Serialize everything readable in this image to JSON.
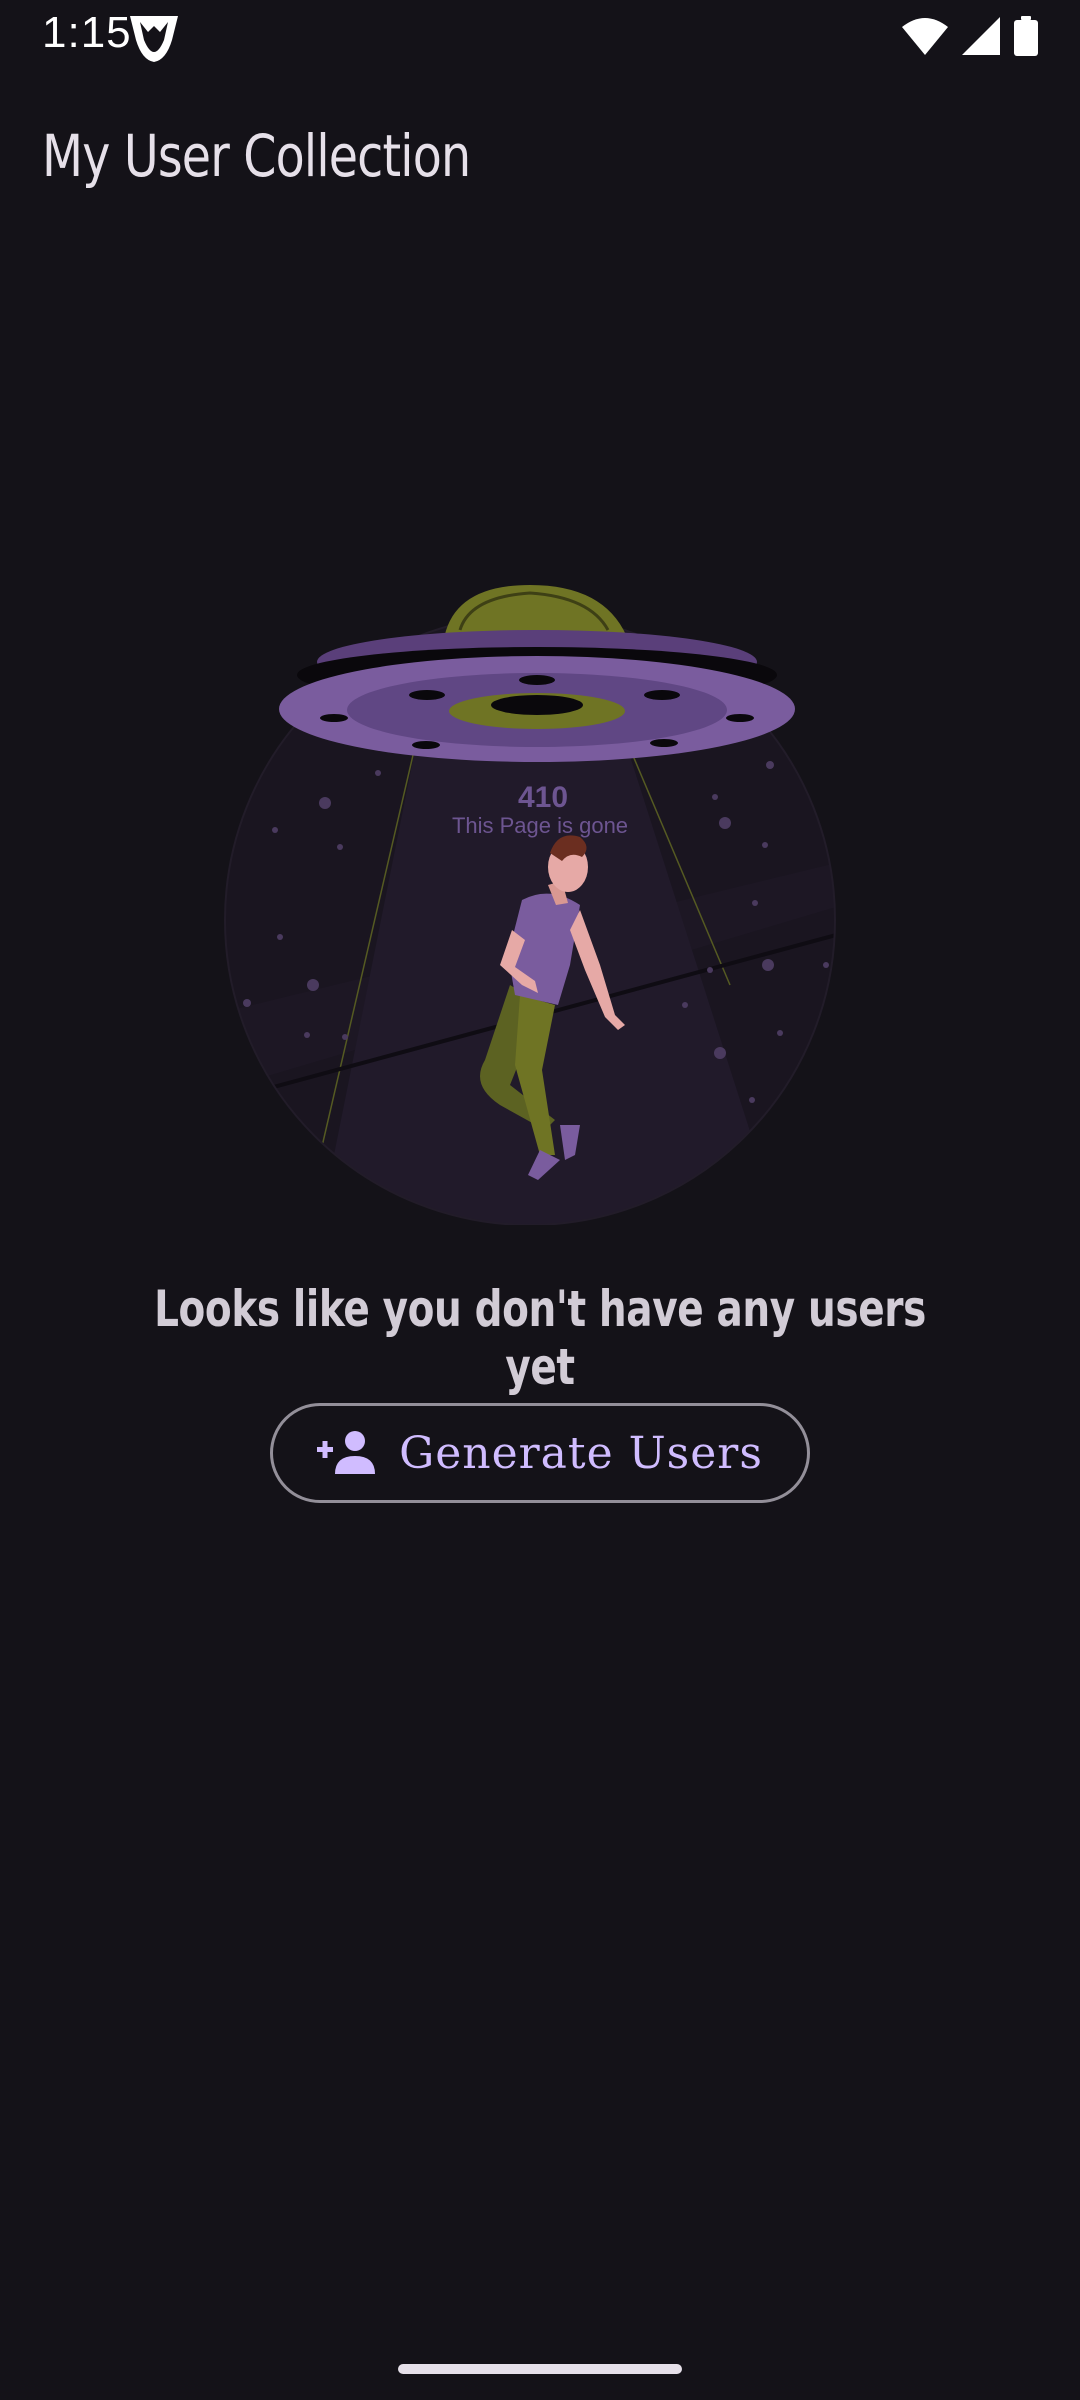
{
  "status_bar": {
    "time": "1:15",
    "icons": [
      "notification-app-icon",
      "wifi-icon",
      "cellular-signal-icon",
      "battery-icon"
    ]
  },
  "app_bar": {
    "title": "My User Collection"
  },
  "illustration": {
    "code": "410",
    "caption": "This Page is gone"
  },
  "empty_state": {
    "message": "Looks like you don't have any users yet"
  },
  "generate_button": {
    "label": "Generate Users",
    "icon": "person-add-icon"
  },
  "colors": {
    "background": "#141218",
    "primary": "#d0bcff",
    "outline": "#938f99",
    "ufo_purple": "#7a5c9e",
    "ufo_olive": "#6f7424"
  }
}
